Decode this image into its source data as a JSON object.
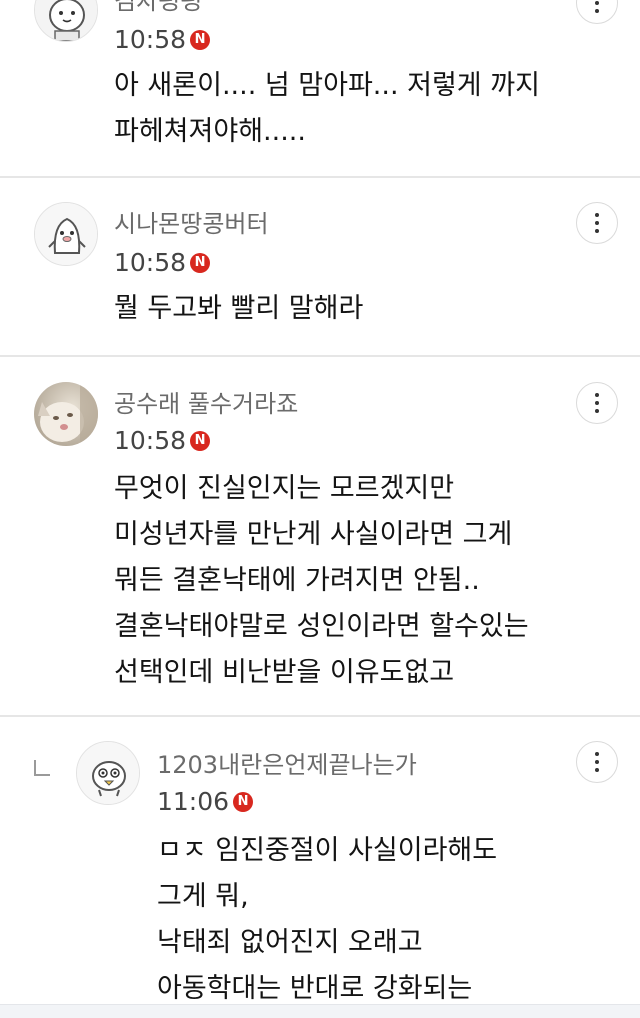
{
  "comments": [
    {
      "nickname": "김차평평",
      "time": "10:58",
      "new_badge": "N",
      "lines": [
        "아 새론이.... 넘 맘아파... 저렇게 까지",
        "파헤쳐져야해....."
      ]
    },
    {
      "nickname": "시나몬땅콩버터",
      "time": "10:58",
      "new_badge": "N",
      "lines": [
        "뭘 두고봐 빨리 말해라"
      ]
    },
    {
      "nickname": "공수래 풀수거라죠",
      "time": "10:58",
      "new_badge": "N",
      "lines": [
        "무엇이 진실인지는 모르겠지만",
        "미성년자를 만난게 사실이라면 그게",
        "뭐든 결혼낙태에 가려지면 안됨..",
        "결혼낙태야말로 성인이라면 할수있는",
        "선택인데 비난받을 이유도없고"
      ]
    },
    {
      "nickname": "1203내란은언제끝나는가",
      "time": "11:06",
      "new_badge": "N",
      "lines": [
        "ㅁㅈ 임진중절이 사실이라해도",
        "그게 뭐,",
        "낙태죄 없어진지 오래고",
        "아동학대는 반대로 강화되는"
      ]
    }
  ],
  "icons": {
    "more": "more-vertical-icon",
    "new": "new-badge-icon",
    "reply": "reply-arrow-icon"
  },
  "colors": {
    "new_badge": "#d8281f",
    "nickname": "#6b6b6b",
    "divider": "#e6e6e6"
  }
}
